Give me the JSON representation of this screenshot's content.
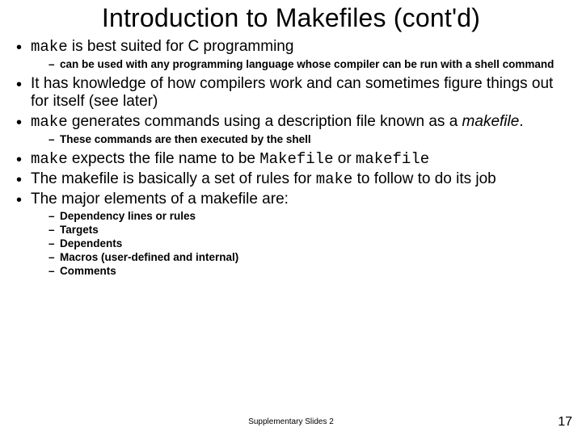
{
  "title": "Introduction to Makefiles (cont'd)",
  "bullets": [
    {
      "parts": [
        {
          "text": "make",
          "mono": true
        },
        {
          "text": " is best suited for C programming"
        }
      ],
      "sub": [
        "can be used with any programming language whose compiler can be run with a shell command"
      ]
    },
    {
      "parts": [
        {
          "text": "It has knowledge of how compilers work and can sometimes figure things out for itself (see later)"
        }
      ]
    },
    {
      "parts": [
        {
          "text": "make",
          "mono": true
        },
        {
          "text": " generates commands using a description file known as a "
        },
        {
          "text": "makefile",
          "italic": true
        },
        {
          "text": "."
        }
      ],
      "sub": [
        "These commands are then executed by the shell"
      ]
    },
    {
      "parts": [
        {
          "text": "make",
          "mono": true
        },
        {
          "text": " expects the file name to be "
        },
        {
          "text": "Makefile",
          "mono": true
        },
        {
          "text": " or "
        },
        {
          "text": "makefile",
          "mono": true
        }
      ]
    },
    {
      "parts": [
        {
          "text": "The makefile is basically a set of rules for "
        },
        {
          "text": "make",
          "mono": true
        },
        {
          "text": " to follow to do its job"
        }
      ]
    },
    {
      "parts": [
        {
          "text": "The major elements of a makefile are:"
        }
      ],
      "sub": [
        "Dependency lines or rules",
        "Targets",
        "Dependents",
        "Macros (user-defined and internal)",
        "Comments"
      ]
    }
  ],
  "footer": "Supplementary Slides 2",
  "page": "17"
}
